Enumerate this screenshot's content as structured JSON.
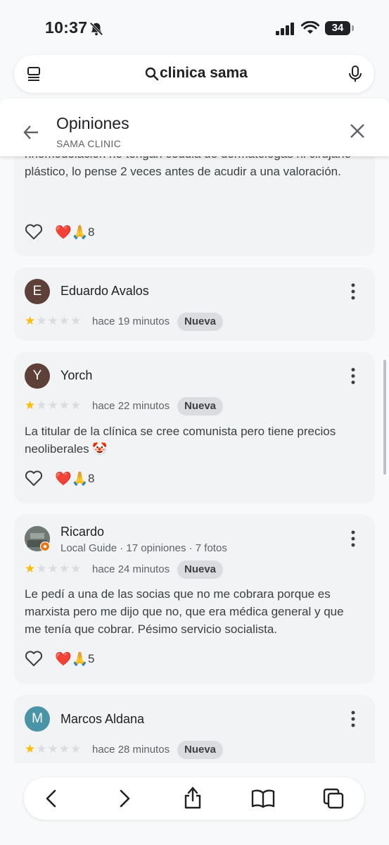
{
  "status": {
    "time": "10:37",
    "battery": "34"
  },
  "search": {
    "query": "clinica sama"
  },
  "header": {
    "title": "Opiniones",
    "subtitle": "SAMA CLINIC"
  },
  "reviews": [
    {
      "text": "rinomodelación no tengan cédula de dermatologas ni cirujano plástico, lo pense 2 veces antes de acudir a una valoración.",
      "reactions": "❤️🙏",
      "count": "8"
    },
    {
      "avatar_letter": "E",
      "avatar_color": "#5d4037",
      "name": "Eduardo Avalos",
      "rating": 1,
      "time": "hace 19 minutos",
      "badge": "Nueva"
    },
    {
      "avatar_letter": "Y",
      "avatar_color": "#5d4037",
      "name": "Yorch",
      "rating": 1,
      "time": "hace 22 minutos",
      "badge": "Nueva",
      "text": "La titular de la clínica se cree comunista pero tiene precios neoliberales 🤡",
      "reactions": "❤️🙏",
      "count": "8"
    },
    {
      "name": "Ricardo",
      "guide": "Local Guide · 17 opiniones · 7 fotos",
      "rating": 1,
      "time": "hace 24 minutos",
      "badge": "Nueva",
      "text": "Le pedí a una de las socias que no me cobrara porque es marxista pero me dijo que no, que era médica general y que me tenía que cobrar. Pésimo servicio socialista.",
      "reactions": "❤️🙏",
      "count": "5"
    },
    {
      "avatar_letter": "M",
      "avatar_color": "#4a94a8",
      "name": "Marcos Aldana",
      "rating": 1,
      "time": "hace 28 minutos",
      "badge": "Nueva"
    }
  ],
  "icons": {
    "status": [
      "bell-off-icon",
      "signal-icon",
      "wifi-icon",
      "battery-icon"
    ],
    "search": [
      "menu-icon",
      "search-icon",
      "mic-icon"
    ],
    "header": [
      "back-arrow-icon",
      "close-icon"
    ],
    "review": [
      "heart-icon",
      "more-vert-icon",
      "star-icon"
    ],
    "nav": [
      "back-icon",
      "forward-icon",
      "share-icon",
      "bookmarks-icon",
      "tabs-icon"
    ]
  },
  "colors": {
    "star": "#fbbc04",
    "star_empty": "#dadce0",
    "card": "#f1f3f4",
    "badge": "#dadce0"
  }
}
